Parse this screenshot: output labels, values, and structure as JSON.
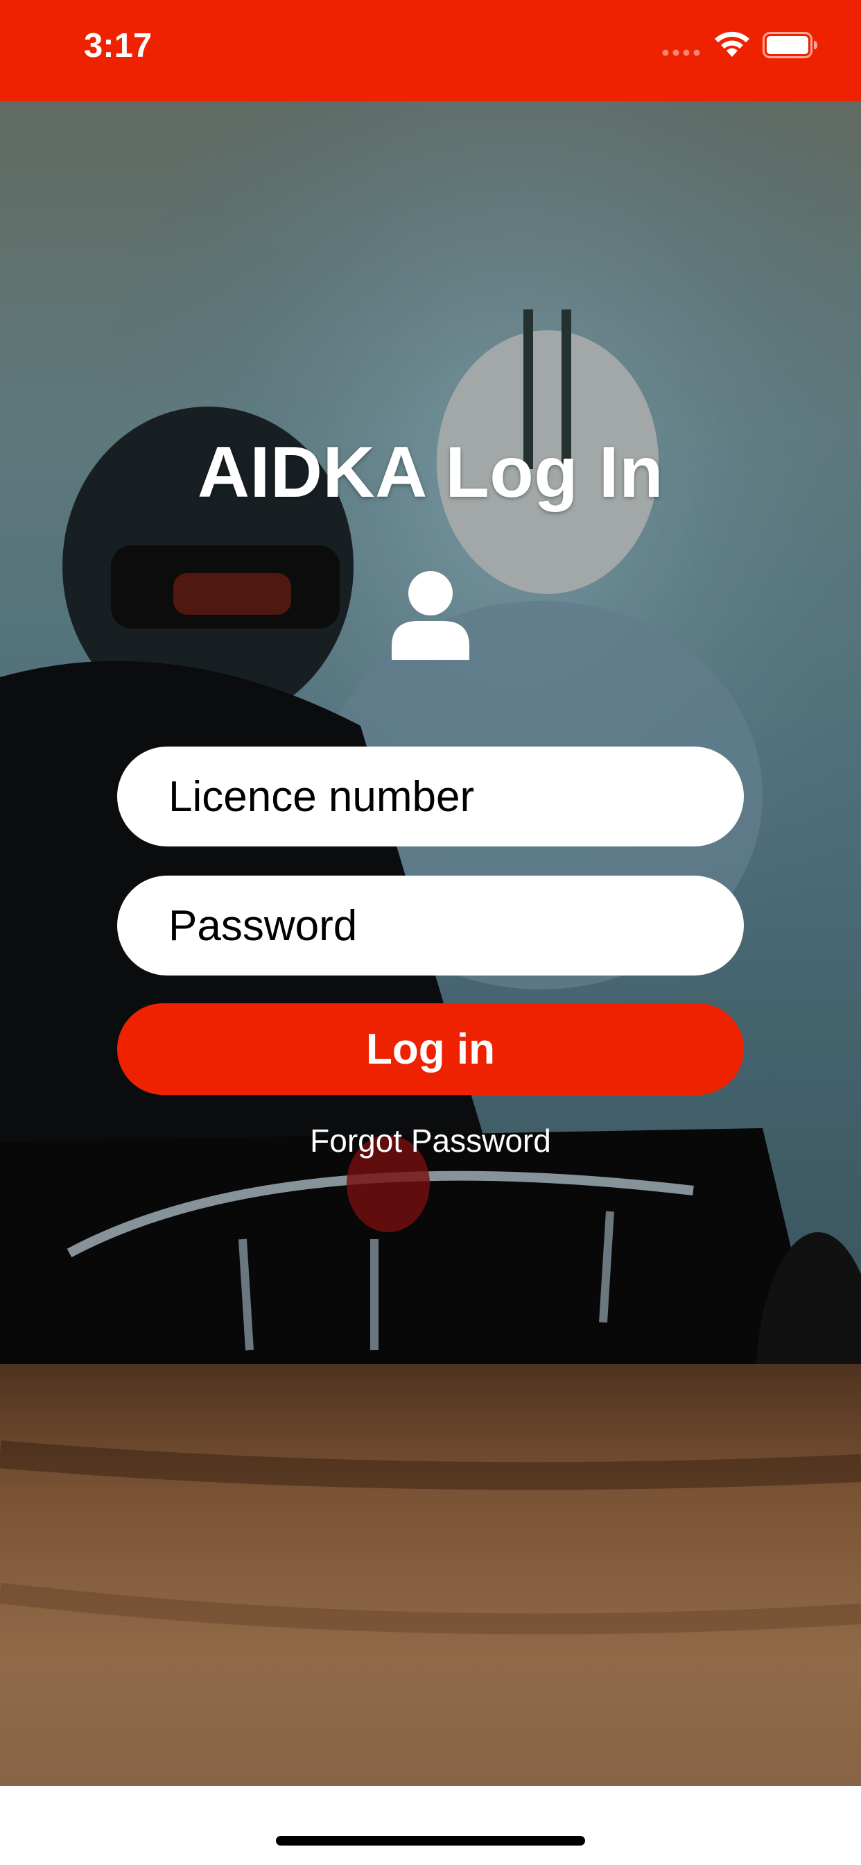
{
  "status_bar": {
    "time": "3:17",
    "background_color": "#ee2200",
    "icons": [
      "signal-icon",
      "wifi-icon",
      "battery-icon"
    ]
  },
  "background": {
    "description_icon": "kart-racing-photo"
  },
  "login": {
    "title": "AIDKA Log In",
    "user_icon": "user-icon",
    "licence_placeholder": "Licence number",
    "licence_value": "",
    "password_placeholder": "Password",
    "password_value": "",
    "login_button_label": "Log in",
    "forgot_password_label": "Forgot Password",
    "accent_color": "#ee2200"
  }
}
